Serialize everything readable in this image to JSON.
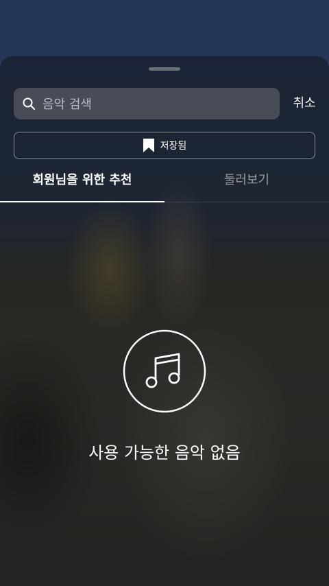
{
  "search": {
    "placeholder": "음악 검색",
    "cancel_label": "취소"
  },
  "saved_button": {
    "label": "저장됨"
  },
  "tabs": [
    {
      "label": "회원님을 위한 추천",
      "active": true
    },
    {
      "label": "둘러보기",
      "active": false
    }
  ],
  "empty_state": {
    "message": "사용 가능한 음악 없음",
    "icon": "music-note-icon"
  },
  "colors": {
    "background_top": "#243657",
    "search_box": "#484c56",
    "text_primary": "#ffffff",
    "text_secondary": "#9a9a9a"
  }
}
